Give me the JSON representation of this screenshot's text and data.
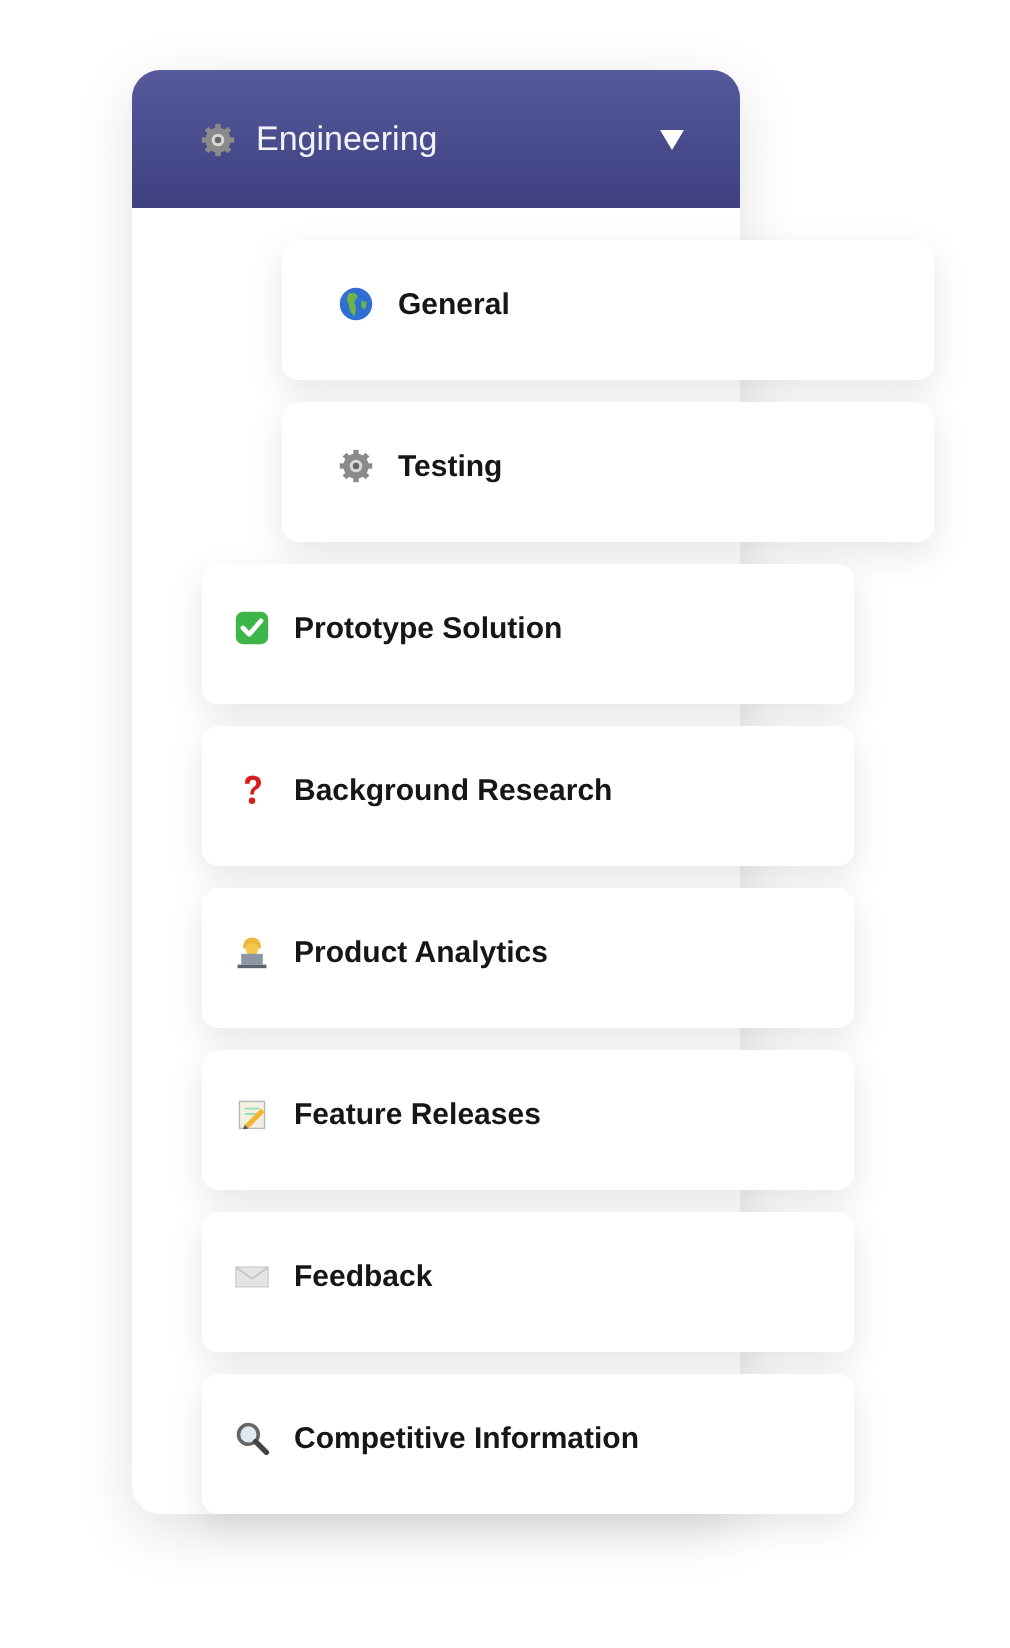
{
  "section": {
    "title": "Engineering",
    "expanded": true
  },
  "sub_items": [
    {
      "label": "General"
    },
    {
      "label": "Testing"
    }
  ],
  "items": [
    {
      "label": "Prototype Solution"
    },
    {
      "label": "Background Research"
    },
    {
      "label": "Product Analytics"
    },
    {
      "label": "Feature Releases"
    },
    {
      "label": "Feedback"
    },
    {
      "label": "Competitive Information"
    }
  ]
}
